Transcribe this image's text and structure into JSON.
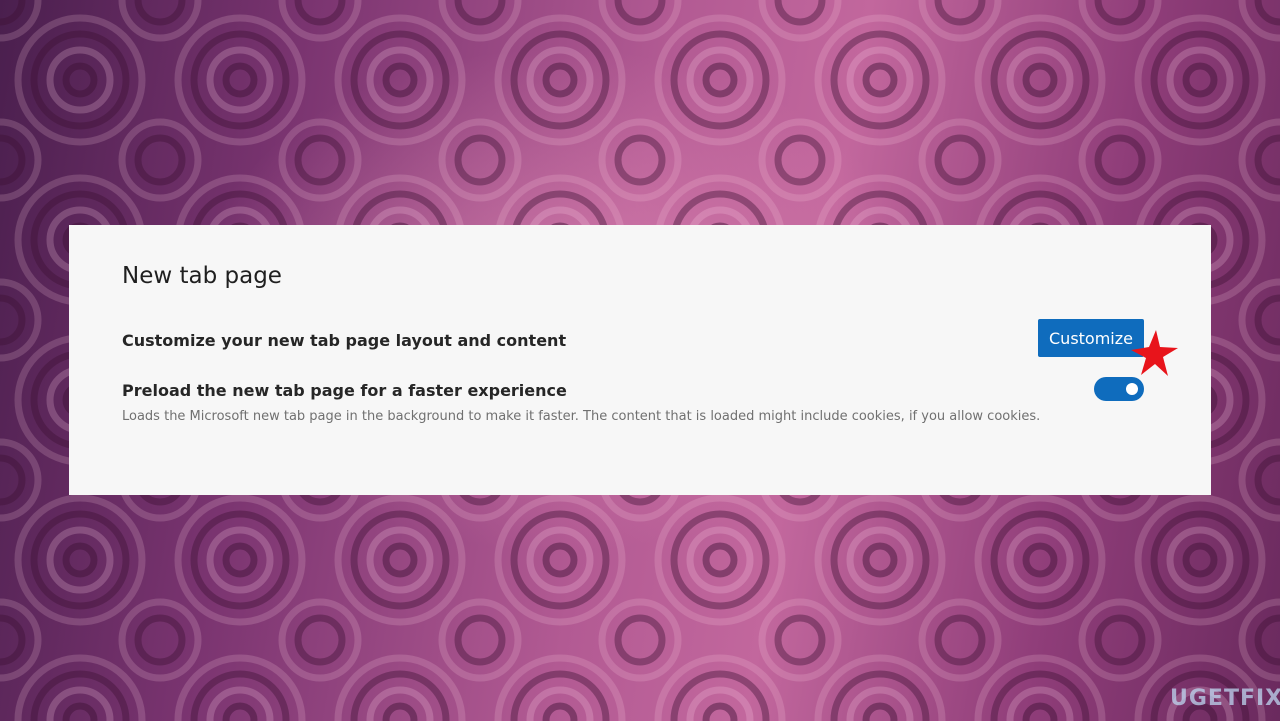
{
  "settings_section": {
    "title": "New tab page",
    "customize_row": {
      "label": "Customize your new tab page layout and content",
      "button_label": "Customize"
    },
    "preload_row": {
      "label": "Preload the new tab page for a faster experience",
      "description": "Loads the Microsoft new tab page in the background to make it faster. The content that is loaded might include cookies, if you allow cookies.",
      "toggle_on": true
    }
  },
  "annotation": {
    "marker": "red-star-icon",
    "marker_color": "#e8141b"
  },
  "watermark": {
    "text": "UGETFIX"
  },
  "colors": {
    "accent": "#0f6cbd",
    "panel_background": "#f7f7f7",
    "page_background": "#8a3d74"
  }
}
